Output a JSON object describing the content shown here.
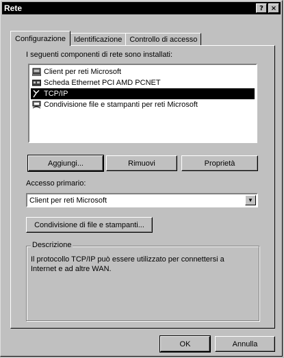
{
  "window": {
    "title": "Rete",
    "help_btn": "?",
    "close_btn": "×"
  },
  "tabs": [
    {
      "label": "Configurazione",
      "active": true
    },
    {
      "label": "Identificazione",
      "active": false
    },
    {
      "label": "Controllo di accesso",
      "active": false
    }
  ],
  "components_label": "I seguenti componenti di rete sono installati:",
  "components": [
    {
      "label": "Client per reti Microsoft",
      "icon": "network-client-icon"
    },
    {
      "label": "Scheda  Ethernet PCI AMD PCNET",
      "icon": "network-adapter-icon"
    },
    {
      "label": "TCP/IP",
      "icon": "protocol-icon",
      "selected": true
    },
    {
      "label": "Condivisione file e stampanti per reti Microsoft",
      "icon": "file-sharing-icon"
    }
  ],
  "buttons": {
    "add": "Aggiungi...",
    "remove": "Rimuovi",
    "properties": "Proprietà"
  },
  "primary_logon_label": "Accesso primario:",
  "primary_logon_value": "Client per reti Microsoft",
  "file_sharing_button": "Condivisione di file e stampanti...",
  "description": {
    "title": "Descrizione",
    "text": "Il protocollo TCP/IP può essere utilizzato per connettersi a Internet e ad altre WAN."
  },
  "footer": {
    "ok": "OK",
    "cancel": "Annulla"
  }
}
